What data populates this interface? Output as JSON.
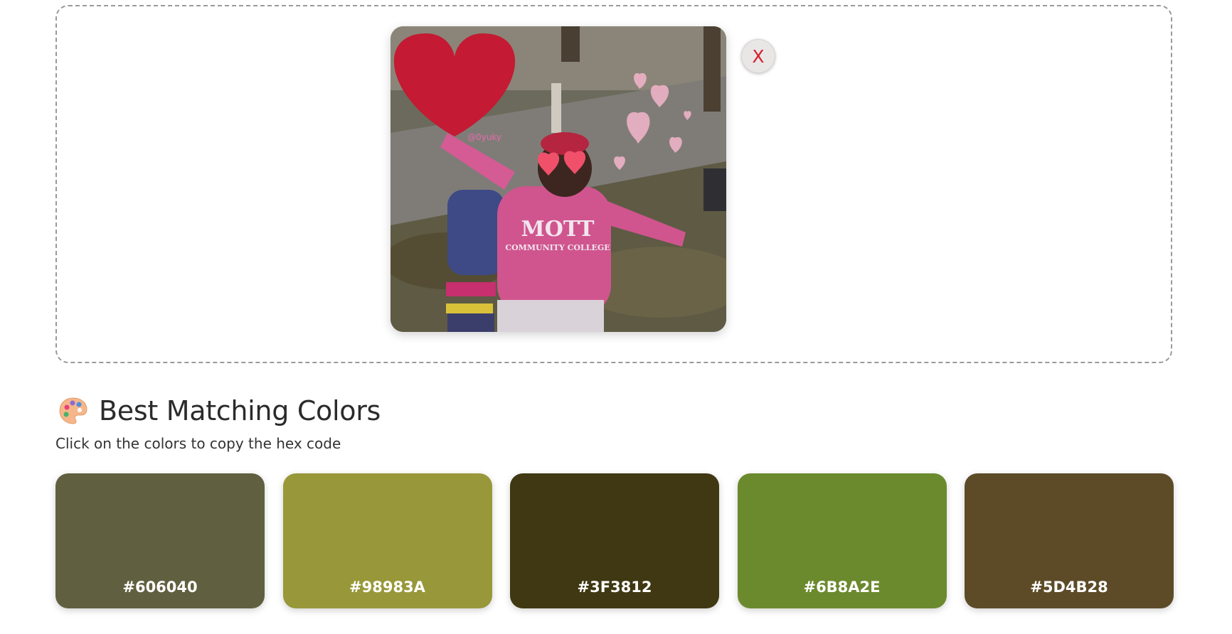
{
  "upload": {
    "preview_caption": "@0yuky",
    "hoodie_text": "MOTT",
    "hoodie_subtext": "COMMUNITY COLLEGE",
    "remove_label": "X"
  },
  "section": {
    "title": "Best Matching Colors",
    "hint": "Click on the colors to copy the hex code",
    "icon": "palette-icon"
  },
  "swatches": [
    {
      "hex": "#606040",
      "label": "#606040"
    },
    {
      "hex": "#98983A",
      "label": "#98983A"
    },
    {
      "hex": "#3F3812",
      "label": "#3F3812"
    },
    {
      "hex": "#6B8A2E",
      "label": "#6B8A2E"
    },
    {
      "hex": "#5D4B28",
      "label": "#5D4B28"
    }
  ]
}
